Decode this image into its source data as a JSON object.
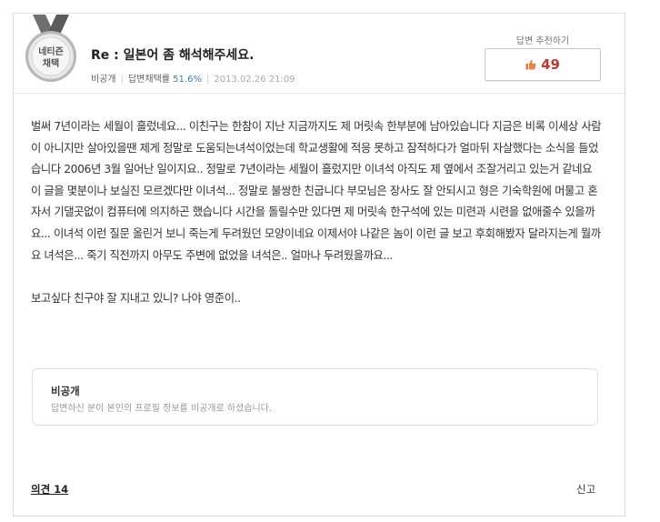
{
  "answer": {
    "badge_line1": "네티즌",
    "badge_line2": "채택",
    "title": "Re : 일본어 좀 해석해주세요.",
    "author": "비공개",
    "adopt_label": "답변채택률",
    "adopt_rate": "51.6%",
    "date": "2013.02.26 21:09"
  },
  "recommend": {
    "label": "답변 추천하기",
    "count": "49"
  },
  "body": {
    "paragraph1": "벌써 7년이라는 세월이 흘렀네요... 이친구는 한참이 지난 지금까지도 제 머릿속 한부분에 남아있습니다 지금은 비록 이세상 사람이 아니지만 살아있을땐 제게 정말로 도움되는녀석이었는데 학교생활에 적응 못하고 잠적하다가 얼마뒤 자살했다는 소식을 들었습니다 2006년 3월 일어난 일이지요.. 정말로 7년이라는 세월이 흘렀지만 이녀석 아직도 제 옆에서 조잘거리고 있는거 같네요 이 글을 몇분이나 보실진 모르겠다만 이녀석... 정말로 불쌍한 친굽니다 부모님은 장사도 잘 안되시고 형은 기숙학원에 머물고 혼자서 기댈곳없이 컴퓨터에 의지하곤 했습니다 시간을 돌릴수만 있다면 제 머릿속 한구석에 있는 미련과 시련을 없애줄수 있을까요... 이녀석 이런 질문 올린거 보니 죽는게 두려웠던 모양이네요 이제서야 나같은 놈이 이런 글 보고 후회해봤자 달라지는게 뭘까요 녀석은... 죽기 직전까지 아무도 주변에 없었을 녀석은.. 얼마나 두려웠을까요...",
    "paragraph2": "보고싶다 친구야 잘 지내고 있니? 나야 영준이.."
  },
  "private_box": {
    "title": "비공개",
    "desc": "답변하신 분이 본인의 프로필 정보를 비공개로 하셨습니다."
  },
  "footer": {
    "opinion": "의견 14",
    "report": "신고"
  },
  "colors": {
    "accent_red": "#c0392b",
    "rate_blue": "#3a7fb5",
    "medal_silver": "#9a9a9a",
    "ribbon_gray": "#6f6f6f"
  }
}
